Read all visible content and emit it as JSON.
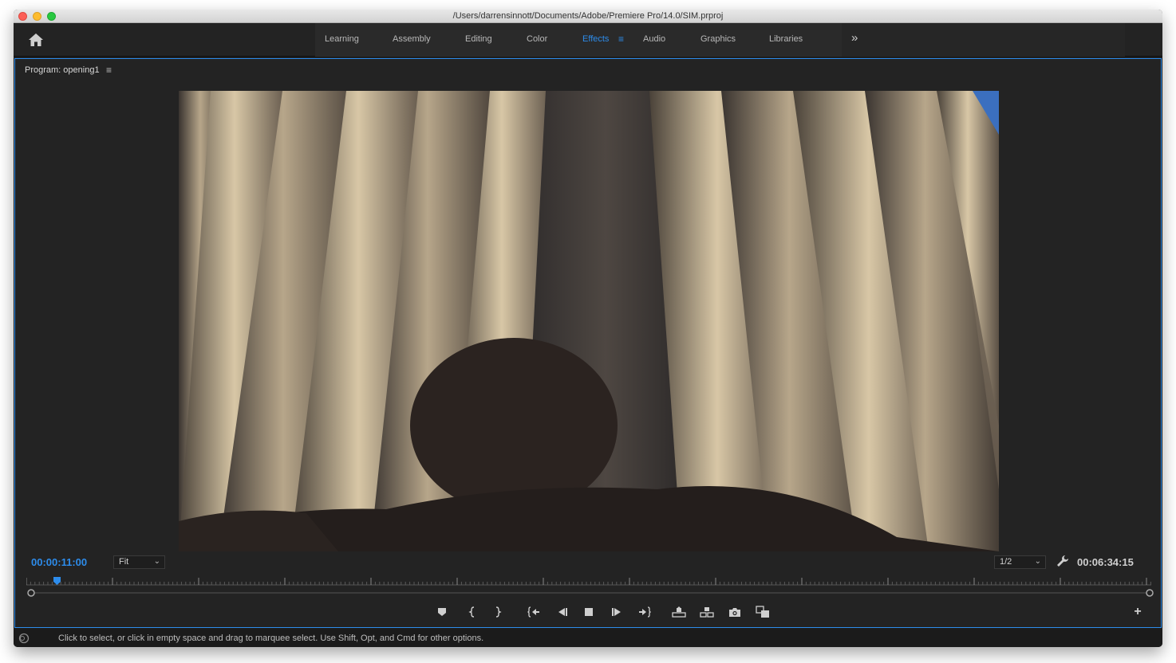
{
  "window": {
    "title": "/Users/darrensinnott/Documents/Adobe/Premiere Pro/14.0/SIM.prproj"
  },
  "workspaces": {
    "items": [
      {
        "label": "Learning",
        "active": false
      },
      {
        "label": "Assembly",
        "active": false
      },
      {
        "label": "Editing",
        "active": false
      },
      {
        "label": "Color",
        "active": false
      },
      {
        "label": "Effects",
        "active": true
      },
      {
        "label": "Audio",
        "active": false
      },
      {
        "label": "Graphics",
        "active": false
      },
      {
        "label": "Libraries",
        "active": false
      }
    ],
    "menu_glyph": "≡",
    "more_glyph": "»"
  },
  "program_monitor": {
    "title": "Program: opening1",
    "menu_glyph": "≡",
    "current_timecode": "00:00:11:00",
    "zoom_level": "Fit",
    "resolution": "1/2",
    "duration_timecode": "00:06:34:15",
    "playhead_position": 0.024,
    "add_button_glyph": "+"
  },
  "transport_controls": [
    {
      "name": "add-marker",
      "icon": "marker-icon"
    },
    {
      "name": "mark-in",
      "icon": "mark-in-icon"
    },
    {
      "name": "mark-out",
      "icon": "mark-out-icon"
    },
    {
      "name": "go-to-in",
      "icon": "go-to-in-icon"
    },
    {
      "name": "step-back",
      "icon": "step-back-icon"
    },
    {
      "name": "stop",
      "icon": "stop-icon"
    },
    {
      "name": "step-forward",
      "icon": "step-forward-icon"
    },
    {
      "name": "go-to-out",
      "icon": "go-to-out-icon"
    },
    {
      "name": "lift",
      "icon": "lift-icon"
    },
    {
      "name": "extract",
      "icon": "extract-icon"
    },
    {
      "name": "export-frame",
      "icon": "camera-icon"
    },
    {
      "name": "comparison-view",
      "icon": "comparison-view-icon"
    }
  ],
  "status_bar": {
    "message": "Click to select, or click in empty space and drag to marquee select. Use Shift, Opt, and Cmd for other options."
  },
  "colors": {
    "accent": "#2d8ceb",
    "panel_bg": "#232323",
    "text": "#bdbdbd"
  }
}
